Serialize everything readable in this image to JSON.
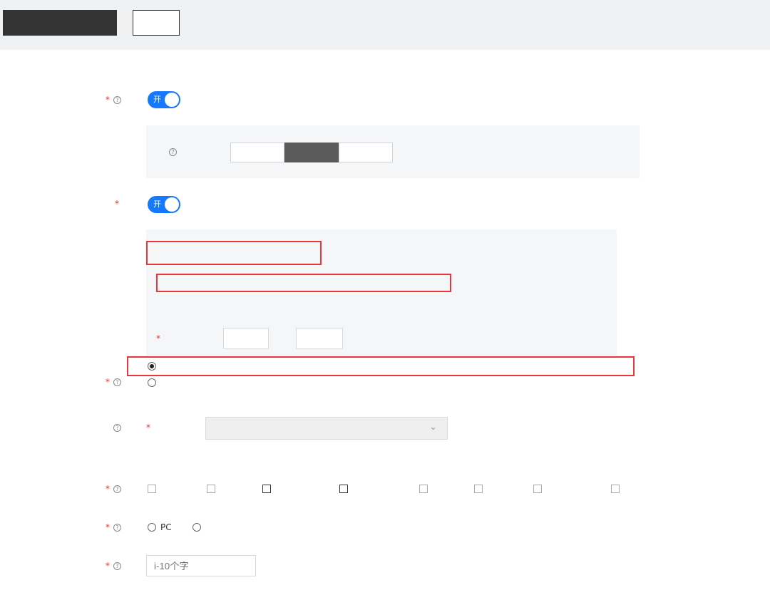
{
  "toolbar": {
    "primary_button": "",
    "secondary_button": ""
  },
  "row1": {
    "label": "",
    "toggle_text": "开",
    "help_line_1": "",
    "help_line_2": ""
  },
  "method_panel": {
    "label": "",
    "segments": [
      "",
      "",
      ""
    ],
    "active_index": 1
  },
  "row2": {
    "label": "",
    "toggle_text": "开",
    "help_line_1": "",
    "help_line_2": ""
  },
  "rule_panel": {
    "title": "",
    "toggle_link": "",
    "lines": [
      "",
      "",
      ""
    ],
    "range": {
      "label": "",
      "separator": "",
      "from_value": "",
      "to_value": ""
    }
  },
  "radio_group": {
    "label": "",
    "options": [
      {
        "title": "",
        "desc": "",
        "checked": true
      },
      {
        "title": "",
        "desc": "",
        "checked": false
      }
    ]
  },
  "select_row": {
    "label": "",
    "sub_label": "",
    "placeholder": ""
  },
  "checkbox_row": {
    "label": "",
    "help": "",
    "options": [
      {
        "label": "",
        "checked": false
      },
      {
        "label": "",
        "checked": false
      },
      {
        "label": "",
        "checked": true
      },
      {
        "label": "",
        "checked": true
      },
      {
        "label": "",
        "checked": false
      },
      {
        "label": "",
        "checked": false
      },
      {
        "label": "",
        "checked": false
      },
      {
        "label": "",
        "checked": false
      }
    ]
  },
  "platform_row": {
    "label": "",
    "options": [
      {
        "label": "PC",
        "checked": false
      },
      {
        "label": "",
        "checked": false
      }
    ]
  },
  "text_row": {
    "label": "",
    "placeholder": "i-10个字"
  },
  "colors": {
    "accent": "#1677ff",
    "highlight": "#e8363c",
    "dark": "#333333"
  }
}
